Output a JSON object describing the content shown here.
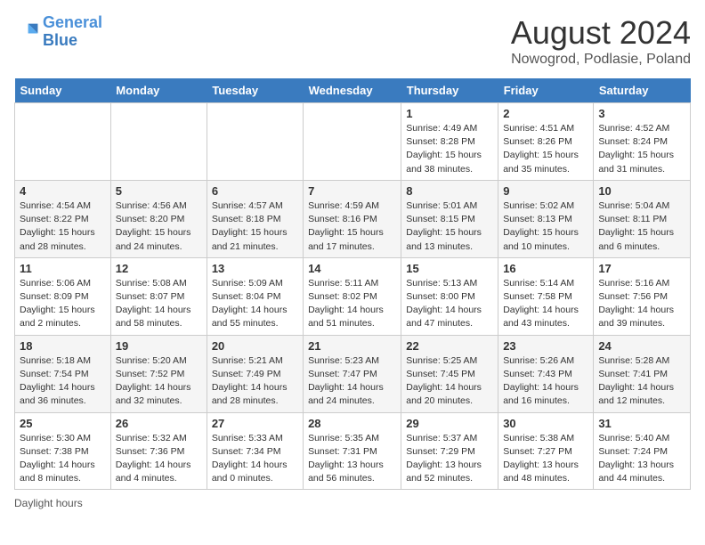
{
  "header": {
    "logo_text_general": "General",
    "logo_text_blue": "Blue",
    "main_title": "August 2024",
    "subtitle": "Nowogrod, Podlasie, Poland"
  },
  "days_of_week": [
    "Sunday",
    "Monday",
    "Tuesday",
    "Wednesday",
    "Thursday",
    "Friday",
    "Saturday"
  ],
  "weeks": [
    [
      {
        "day": "",
        "info": ""
      },
      {
        "day": "",
        "info": ""
      },
      {
        "day": "",
        "info": ""
      },
      {
        "day": "",
        "info": ""
      },
      {
        "day": "1",
        "info": "Sunrise: 4:49 AM\nSunset: 8:28 PM\nDaylight: 15 hours and 38 minutes."
      },
      {
        "day": "2",
        "info": "Sunrise: 4:51 AM\nSunset: 8:26 PM\nDaylight: 15 hours and 35 minutes."
      },
      {
        "day": "3",
        "info": "Sunrise: 4:52 AM\nSunset: 8:24 PM\nDaylight: 15 hours and 31 minutes."
      }
    ],
    [
      {
        "day": "4",
        "info": "Sunrise: 4:54 AM\nSunset: 8:22 PM\nDaylight: 15 hours and 28 minutes."
      },
      {
        "day": "5",
        "info": "Sunrise: 4:56 AM\nSunset: 8:20 PM\nDaylight: 15 hours and 24 minutes."
      },
      {
        "day": "6",
        "info": "Sunrise: 4:57 AM\nSunset: 8:18 PM\nDaylight: 15 hours and 21 minutes."
      },
      {
        "day": "7",
        "info": "Sunrise: 4:59 AM\nSunset: 8:16 PM\nDaylight: 15 hours and 17 minutes."
      },
      {
        "day": "8",
        "info": "Sunrise: 5:01 AM\nSunset: 8:15 PM\nDaylight: 15 hours and 13 minutes."
      },
      {
        "day": "9",
        "info": "Sunrise: 5:02 AM\nSunset: 8:13 PM\nDaylight: 15 hours and 10 minutes."
      },
      {
        "day": "10",
        "info": "Sunrise: 5:04 AM\nSunset: 8:11 PM\nDaylight: 15 hours and 6 minutes."
      }
    ],
    [
      {
        "day": "11",
        "info": "Sunrise: 5:06 AM\nSunset: 8:09 PM\nDaylight: 15 hours and 2 minutes."
      },
      {
        "day": "12",
        "info": "Sunrise: 5:08 AM\nSunset: 8:07 PM\nDaylight: 14 hours and 58 minutes."
      },
      {
        "day": "13",
        "info": "Sunrise: 5:09 AM\nSunset: 8:04 PM\nDaylight: 14 hours and 55 minutes."
      },
      {
        "day": "14",
        "info": "Sunrise: 5:11 AM\nSunset: 8:02 PM\nDaylight: 14 hours and 51 minutes."
      },
      {
        "day": "15",
        "info": "Sunrise: 5:13 AM\nSunset: 8:00 PM\nDaylight: 14 hours and 47 minutes."
      },
      {
        "day": "16",
        "info": "Sunrise: 5:14 AM\nSunset: 7:58 PM\nDaylight: 14 hours and 43 minutes."
      },
      {
        "day": "17",
        "info": "Sunrise: 5:16 AM\nSunset: 7:56 PM\nDaylight: 14 hours and 39 minutes."
      }
    ],
    [
      {
        "day": "18",
        "info": "Sunrise: 5:18 AM\nSunset: 7:54 PM\nDaylight: 14 hours and 36 minutes."
      },
      {
        "day": "19",
        "info": "Sunrise: 5:20 AM\nSunset: 7:52 PM\nDaylight: 14 hours and 32 minutes."
      },
      {
        "day": "20",
        "info": "Sunrise: 5:21 AM\nSunset: 7:49 PM\nDaylight: 14 hours and 28 minutes."
      },
      {
        "day": "21",
        "info": "Sunrise: 5:23 AM\nSunset: 7:47 PM\nDaylight: 14 hours and 24 minutes."
      },
      {
        "day": "22",
        "info": "Sunrise: 5:25 AM\nSunset: 7:45 PM\nDaylight: 14 hours and 20 minutes."
      },
      {
        "day": "23",
        "info": "Sunrise: 5:26 AM\nSunset: 7:43 PM\nDaylight: 14 hours and 16 minutes."
      },
      {
        "day": "24",
        "info": "Sunrise: 5:28 AM\nSunset: 7:41 PM\nDaylight: 14 hours and 12 minutes."
      }
    ],
    [
      {
        "day": "25",
        "info": "Sunrise: 5:30 AM\nSunset: 7:38 PM\nDaylight: 14 hours and 8 minutes."
      },
      {
        "day": "26",
        "info": "Sunrise: 5:32 AM\nSunset: 7:36 PM\nDaylight: 14 hours and 4 minutes."
      },
      {
        "day": "27",
        "info": "Sunrise: 5:33 AM\nSunset: 7:34 PM\nDaylight: 14 hours and 0 minutes."
      },
      {
        "day": "28",
        "info": "Sunrise: 5:35 AM\nSunset: 7:31 PM\nDaylight: 13 hours and 56 minutes."
      },
      {
        "day": "29",
        "info": "Sunrise: 5:37 AM\nSunset: 7:29 PM\nDaylight: 13 hours and 52 minutes."
      },
      {
        "day": "30",
        "info": "Sunrise: 5:38 AM\nSunset: 7:27 PM\nDaylight: 13 hours and 48 minutes."
      },
      {
        "day": "31",
        "info": "Sunrise: 5:40 AM\nSunset: 7:24 PM\nDaylight: 13 hours and 44 minutes."
      }
    ]
  ],
  "footer": {
    "daylight_label": "Daylight hours"
  }
}
